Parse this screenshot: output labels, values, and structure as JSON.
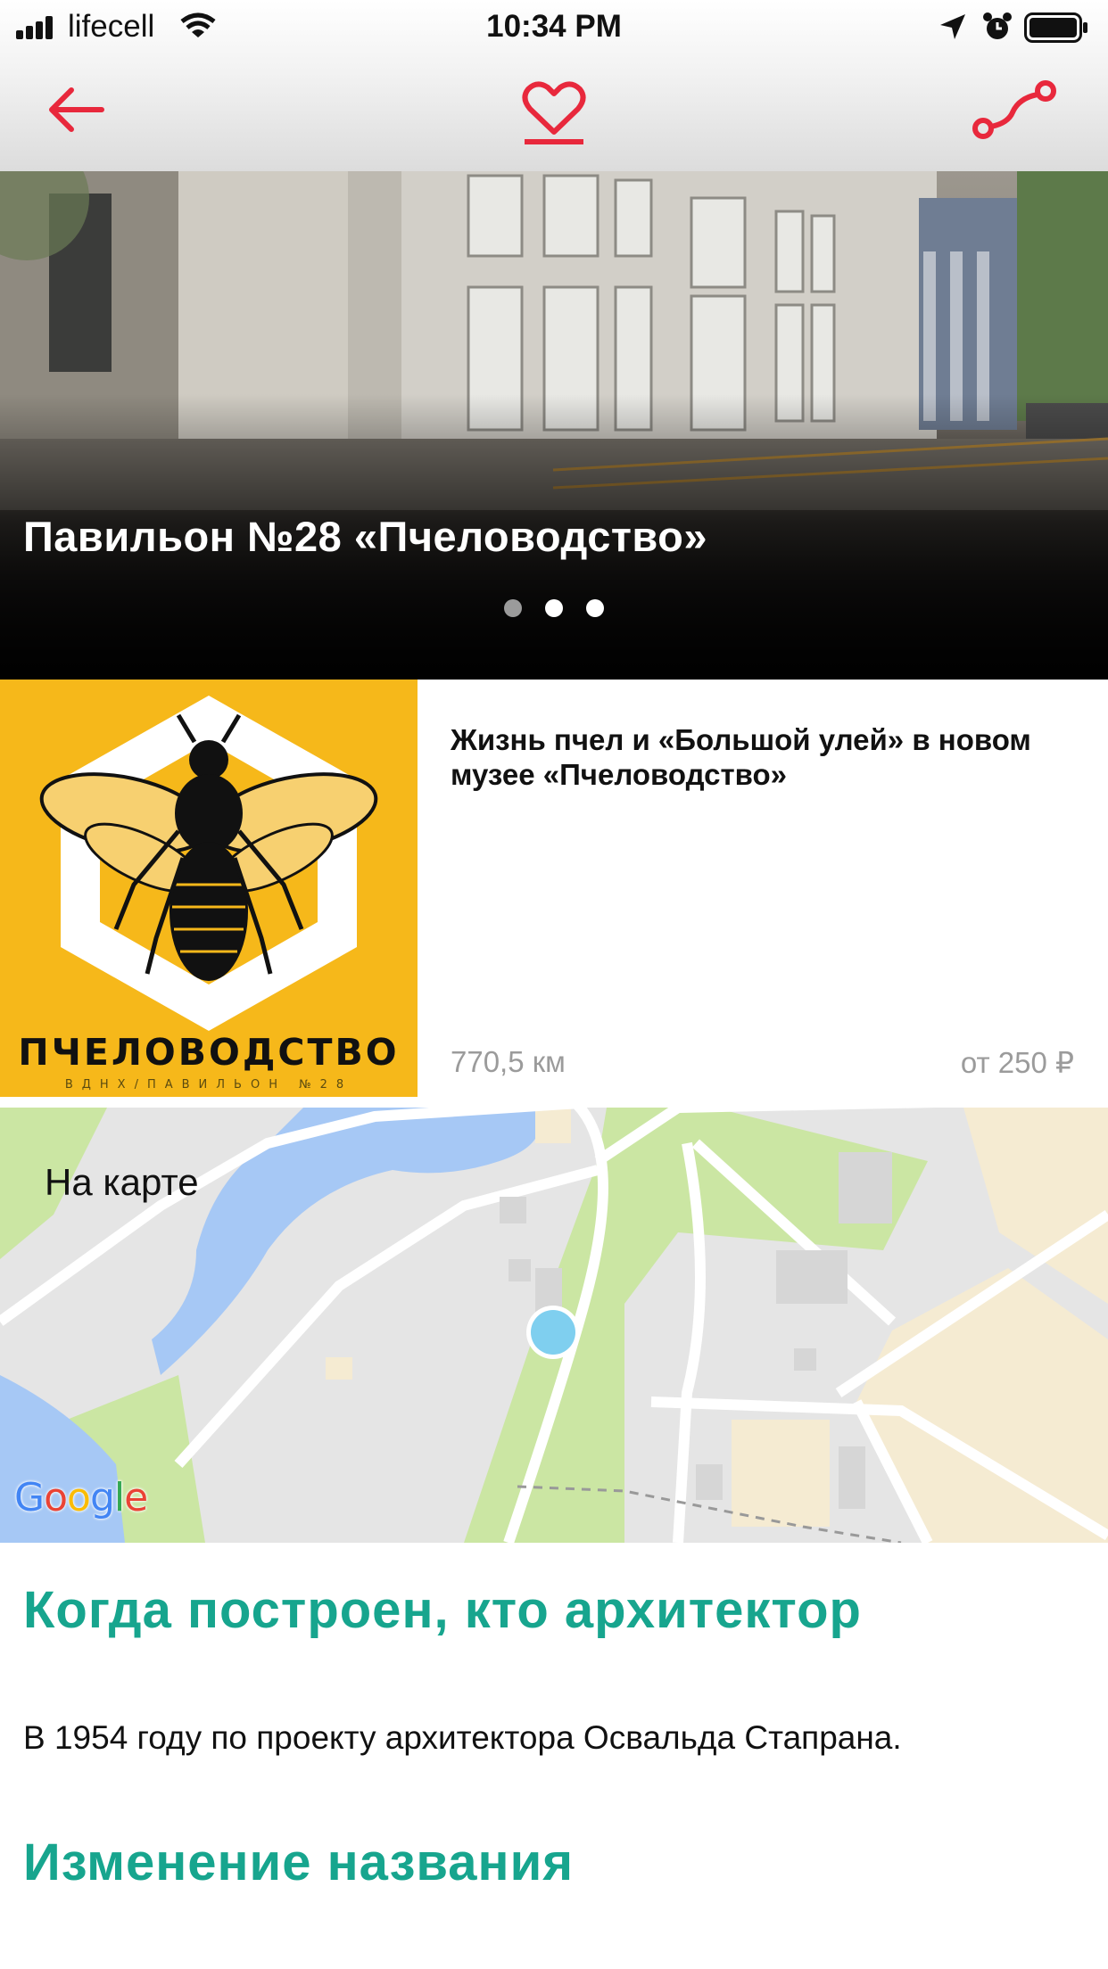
{
  "status_bar": {
    "carrier": "lifecell",
    "time": "10:34 PM"
  },
  "nav": {
    "back_icon": "arrow-left-icon",
    "favorite_icon": "heart-icon",
    "route_icon": "route-icon",
    "accent_color": "#e8283c"
  },
  "hero": {
    "title": "Павильон №28 «Пчеловодство»",
    "slides_total": 3,
    "slide_active": 2
  },
  "event_card": {
    "image_text": "ПЧЕЛОВОДСТВО",
    "image_subtext": "ВДНХ/ПАВИЛЬОН №28",
    "title": "Жизнь пчел и «Большой улей» в новом музее «Пчеловодство»",
    "distance": "770,5 км",
    "price": "от 250 ₽"
  },
  "map": {
    "label": "На карте",
    "provider_logo": "Google"
  },
  "sections": [
    {
      "heading": "Когда построен, кто архитектор",
      "text": "В 1954 году по проекту архитектора Освальда Стапрана."
    },
    {
      "heading": "Изменение названия"
    }
  ],
  "colors": {
    "heading": "#17a58e",
    "accent": "#e8283c"
  }
}
